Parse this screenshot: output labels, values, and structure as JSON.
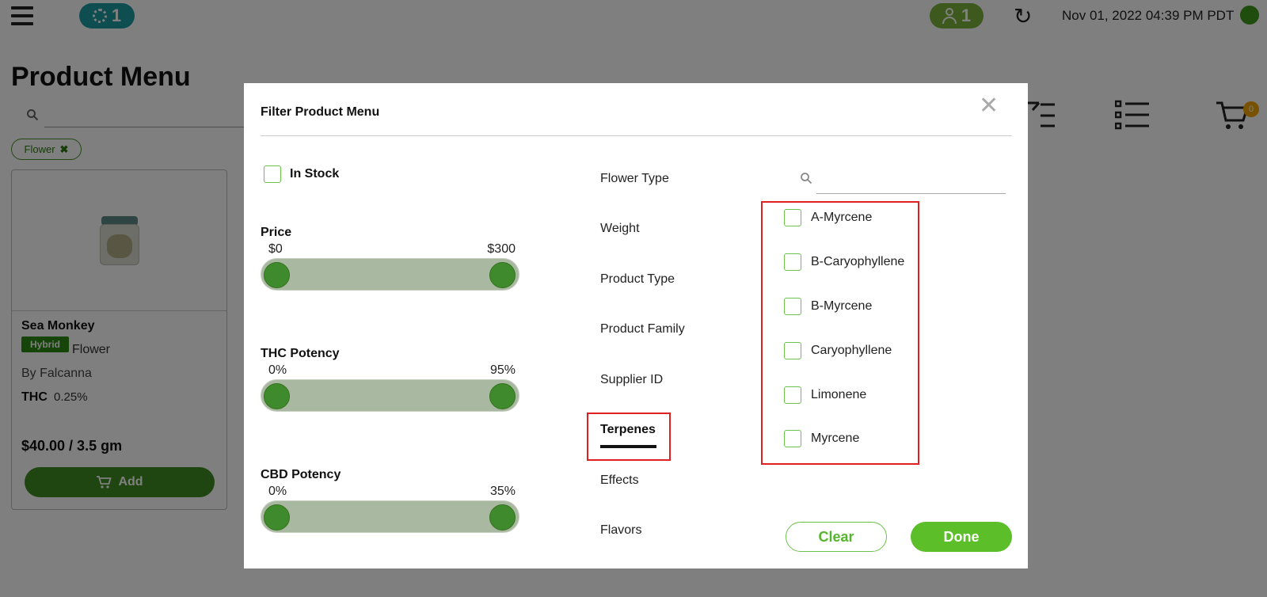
{
  "topbar": {
    "queue_count": "1",
    "user_count": "1",
    "datetime": "Nov 01, 2022 04:39 PM PDT"
  },
  "page": {
    "title": "Product Menu",
    "active_filter_chip": "Flower"
  },
  "product": {
    "name": "Sea Monkey",
    "strain_badge": "Hybrid",
    "category": "Flower",
    "brand": "By Falcanna",
    "thc_label": "THC",
    "thc_value": "0.25%",
    "price": "$40.00 / 3.5 gm",
    "add_label": "Add"
  },
  "cart": {
    "count": "0"
  },
  "modal": {
    "title": "Filter Product Menu",
    "in_stock_label": "In Stock",
    "ranges": [
      {
        "label": "Price",
        "min": "$0",
        "max": "$300"
      },
      {
        "label": "THC Potency",
        "min": "0%",
        "max": "95%"
      },
      {
        "label": "CBD Potency",
        "min": "0%",
        "max": "35%"
      }
    ],
    "categories": [
      "Flower Type",
      "Weight",
      "Product Type",
      "Product Family",
      "Supplier ID",
      "Terpenes",
      "Effects",
      "Flavors"
    ],
    "active_category": "Terpenes",
    "options": [
      "A-Myrcene",
      "B-Caryophyllene",
      "B-Myrcene",
      "Caryophyllene",
      "Limonene",
      "Myrcene"
    ],
    "clear_label": "Clear",
    "done_label": "Done"
  },
  "colors": {
    "accent_green": "#5cbf2a",
    "highlight_red": "#e02020",
    "teal": "#1c9aa0"
  }
}
